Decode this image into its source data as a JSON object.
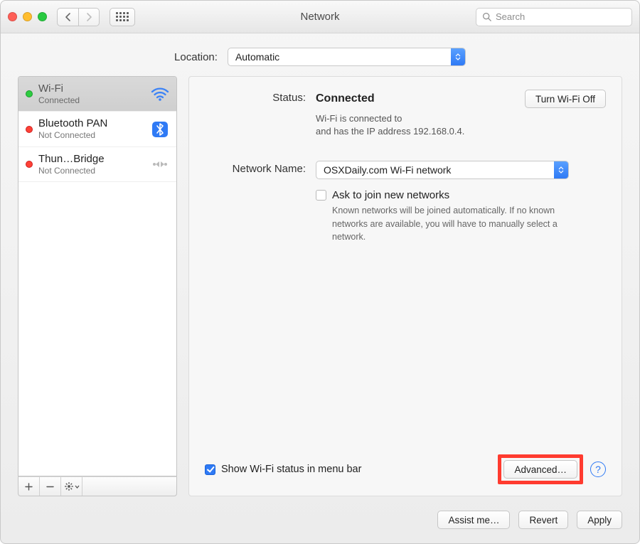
{
  "window": {
    "title": "Network",
    "search_placeholder": "Search"
  },
  "location": {
    "label": "Location:",
    "value": "Automatic"
  },
  "sidebar": {
    "items": [
      {
        "name": "Wi-Fi",
        "status": "Connected",
        "dot": "green",
        "icon": "wifi-icon"
      },
      {
        "name": "Bluetooth PAN",
        "status": "Not Connected",
        "dot": "red",
        "icon": "bluetooth-icon"
      },
      {
        "name": "Thun…Bridge",
        "status": "Not Connected",
        "dot": "red",
        "icon": "thunderbolt-bridge-icon"
      }
    ]
  },
  "detail": {
    "status_label": "Status:",
    "status_value": "Connected",
    "wifi_toggle": "Turn Wi-Fi Off",
    "status_desc_1": "Wi-Fi is connected to",
    "status_desc_2": "and has the IP address 192.168.0.4.",
    "network_name_label": "Network Name:",
    "network_name_value": "OSXDaily.com Wi-Fi network",
    "ask_join_label": "Ask to join new networks",
    "ask_join_checked": false,
    "ask_join_desc": "Known networks will be joined automatically. If no known networks are available, you will have to manually select a network.",
    "show_status_label": "Show Wi-Fi status in menu bar",
    "show_status_checked": true,
    "advanced_label": "Advanced…",
    "help_symbol": "?"
  },
  "footer": {
    "assist": "Assist me…",
    "revert": "Revert",
    "apply": "Apply"
  }
}
